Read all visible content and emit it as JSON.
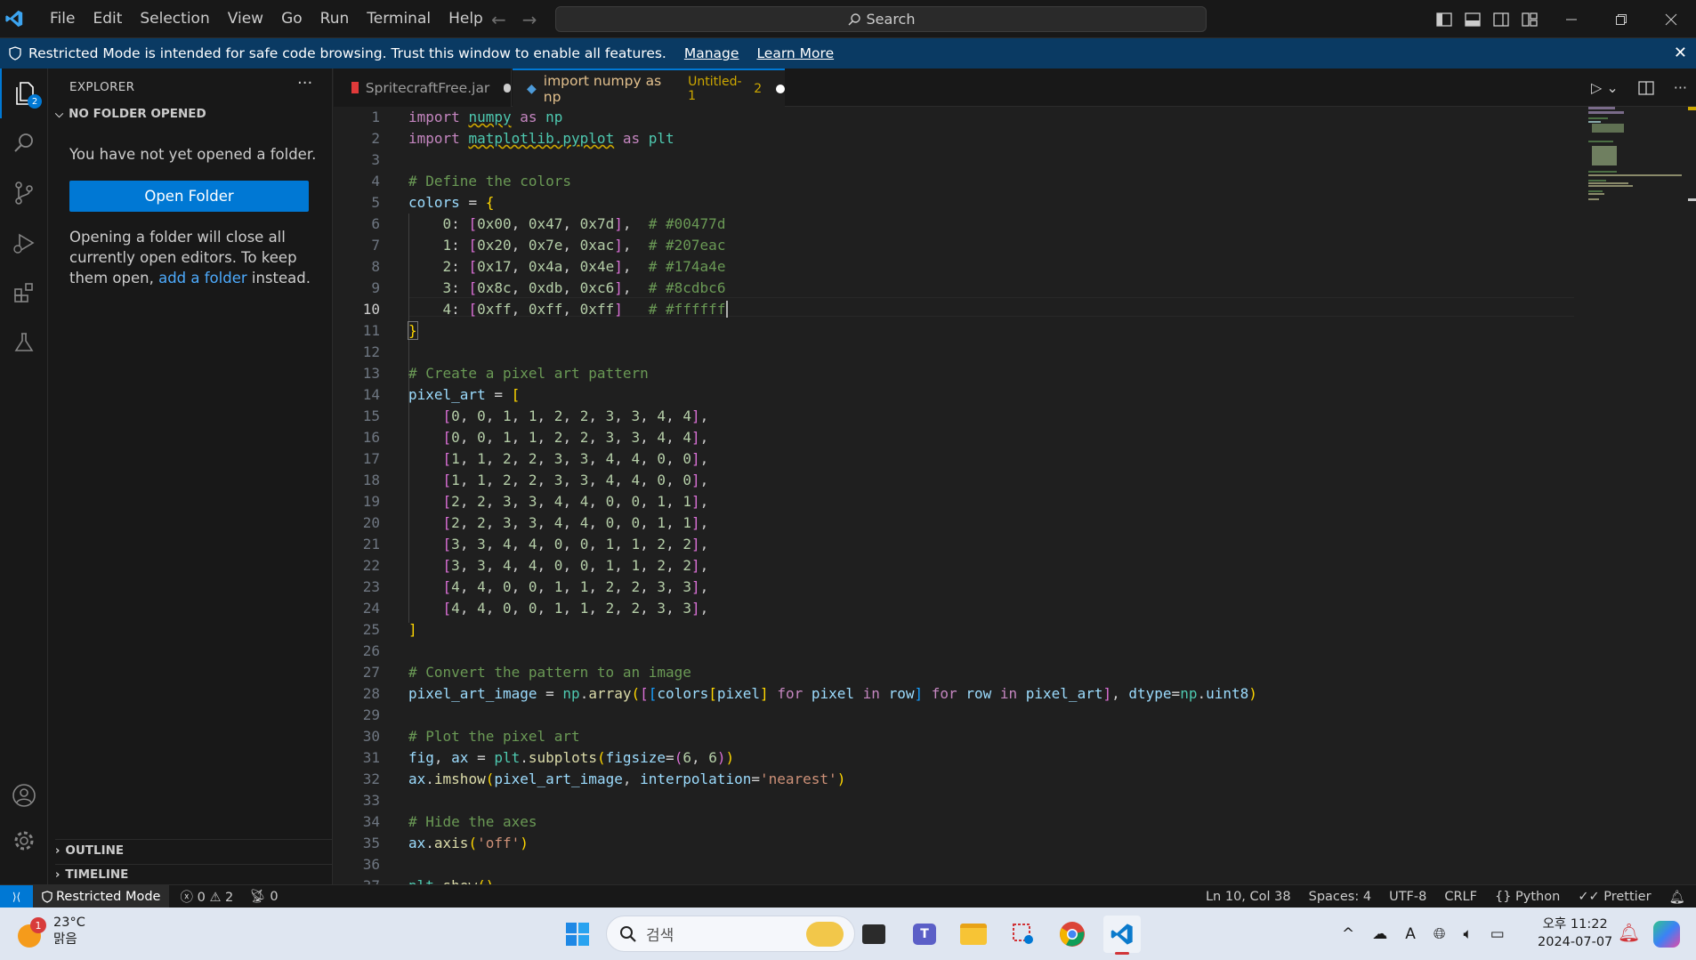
{
  "titlebar": {
    "menu": [
      "File",
      "Edit",
      "Selection",
      "View",
      "Go",
      "Run",
      "Terminal",
      "Help"
    ],
    "search": "Search"
  },
  "banner": {
    "message": "Restricted Mode is intended for safe code browsing. Trust this window to enable all features.",
    "manage": "Manage",
    "learn_more": "Learn More"
  },
  "activity": {
    "explorer_badge": "2"
  },
  "sidebar": {
    "title": "EXPLORER",
    "section": "NO FOLDER OPENED",
    "message": "You have not yet opened a folder.",
    "open_folder": "Open Folder",
    "para_before": "Opening a folder will close all currently open editors. To keep them open, ",
    "para_link": "add a folder",
    "para_after": " instead.",
    "outline": "OUTLINE",
    "timeline": "TIMELINE"
  },
  "tabs": [
    {
      "label": "SpritecraftFree.jar"
    },
    {
      "label": "import numpy as np",
      "detail": "Untitled-1",
      "problems": "2"
    }
  ],
  "editor": {
    "current_line": 10
  },
  "status": {
    "restricted": "Restricted Mode",
    "errors": "0",
    "warnings": "2",
    "ports": "0",
    "position": "Ln 10, Col 38",
    "spaces": "Spaces: 4",
    "encoding": "UTF-8",
    "eol": "CRLF",
    "language": "Python",
    "formatter": "Prettier"
  },
  "taskbar": {
    "weather_badge": "1",
    "temperature": "23°C",
    "weather_text": "맑음",
    "search": "검색",
    "time": "오후 11:22",
    "date": "2024-07-07"
  },
  "colors": {
    "accent": "#0078d4",
    "banner": "#0a3a63"
  }
}
